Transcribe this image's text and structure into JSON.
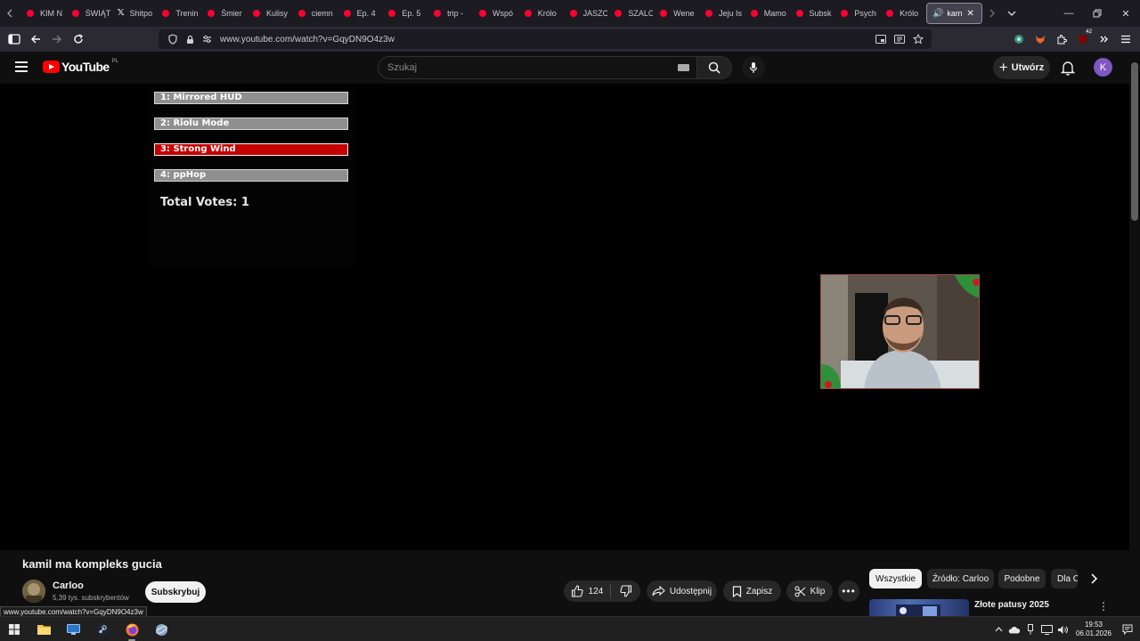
{
  "browser": {
    "tabs": [
      {
        "title": "KIM N",
        "icon": "youtube-icon"
      },
      {
        "title": "ŚWIĄT",
        "icon": "youtube-icon"
      },
      {
        "title": "Shitpo",
        "icon": "x-icon"
      },
      {
        "title": "Trenin",
        "icon": "youtube-icon"
      },
      {
        "title": "Śmier",
        "icon": "youtube-icon"
      },
      {
        "title": "Kulisy",
        "icon": "youtube-icon"
      },
      {
        "title": "ciemn",
        "icon": "youtube-icon"
      },
      {
        "title": "Ep. 4",
        "icon": "youtube-icon"
      },
      {
        "title": "Ep. 5",
        "icon": "youtube-icon"
      },
      {
        "title": "trip - ",
        "icon": "youtube-icon"
      },
      {
        "title": "Wspó",
        "icon": "youtube-icon"
      },
      {
        "title": "Królo",
        "icon": "youtube-icon"
      },
      {
        "title": "JASZC",
        "icon": "youtube-icon"
      },
      {
        "title": "SZALC",
        "icon": "youtube-icon"
      },
      {
        "title": "Wene",
        "icon": "youtube-icon"
      },
      {
        "title": "Jeju Is",
        "icon": "youtube-icon"
      },
      {
        "title": "Mamo",
        "icon": "youtube-icon"
      },
      {
        "title": "Subsk",
        "icon": "youtube-icon"
      },
      {
        "title": "Psych",
        "icon": "youtube-icon"
      },
      {
        "title": "Królo",
        "icon": "youtube-icon"
      }
    ],
    "active_tab_title": "kam",
    "url": "www.youtube.com/watch?v=GqyDN9O4z3w",
    "extension_badge": "42"
  },
  "youtube": {
    "logo_text": "YouTube",
    "region": "PL",
    "search_placeholder": "Szukaj",
    "create_label": "Utwórz",
    "avatar_letter": "K"
  },
  "poll": {
    "options": [
      "1: Mirrored HUD",
      "2: Riolu Mode",
      "3: Strong Wind",
      "4: ppHop"
    ],
    "selected_index": 2,
    "total_votes": "Total Votes: 1"
  },
  "video": {
    "title": "kamil ma kompleks gucia",
    "channel_name": "Carloo",
    "subscribers": "5,39 tys. subskrybentów",
    "subscribe_label": "Subskrybuj",
    "likes": "124",
    "share_label": "Udostępnij",
    "save_label": "Zapisz",
    "clip_label": "Klip"
  },
  "sidebar": {
    "chips": [
      "Wszystkie",
      "Źródło: Carloo",
      "Podobne",
      "Dla C"
    ],
    "recommendation_title": "Złote patusy 2025"
  },
  "status_url": "www.youtube.com/watch?v=GqyDN9O4z3w",
  "taskbar": {
    "time": "19:53",
    "date": "06.01.2026"
  },
  "colors": {
    "poll_selected": "#c40000",
    "poll_option": "#8f8f8f",
    "youtube_red": "#ff0000",
    "avatar": "#7e57c2"
  }
}
